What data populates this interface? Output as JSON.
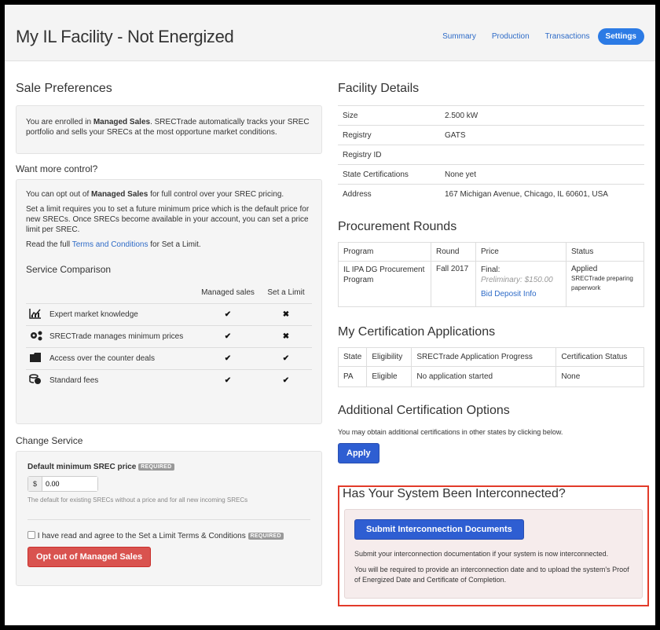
{
  "header": {
    "title": "My IL Facility - Not Energized",
    "nav": [
      "Summary",
      "Production",
      "Transactions",
      "Settings"
    ]
  },
  "sale_preferences": {
    "title": "Sale Preferences",
    "text_1": "You are enrolled in ",
    "text_bold": "Managed Sales",
    "text_2": ". SRECTrade automatically tracks your SREC portfolio and sells your SRECs at the most opportune market conditions."
  },
  "more_control": {
    "title": "Want more control?",
    "p1_a": "You can opt out of ",
    "p1_bold": "Managed Sales",
    "p1_b": " for full control over your SREC pricing.",
    "p2": "Set a limit requires you to set a future minimum price which is the default price for new SRECs. Once SRECs become available in your account, you can set a price limit per SREC.",
    "p3_a": "Read the full ",
    "p3_link": "Terms and Conditions",
    "p3_b": " for Set a Limit."
  },
  "service_comparison": {
    "title": "Service Comparison",
    "col_managed": "Managed sales",
    "col_limit": "Set a Limit",
    "rows": [
      {
        "icon": "chart-icon",
        "label": "Expert market knowledge",
        "managed": "✔",
        "limit": "✖"
      },
      {
        "icon": "gears-icon",
        "label": "SRECTrade manages minimum prices",
        "managed": "✔",
        "limit": "✖"
      },
      {
        "icon": "folder-icon",
        "label": "Access over the counter deals",
        "managed": "✔",
        "limit": "✔"
      },
      {
        "icon": "coins-icon",
        "label": "Standard fees",
        "managed": "✔",
        "limit": "✔"
      }
    ]
  },
  "change_service": {
    "title": "Change Service",
    "price_label": "Default minimum SREC price",
    "required": "REQUIRED",
    "currency": "$",
    "price_value": "0.00",
    "help": "The default for existing SRECs without a price and for all new incoming SRECs",
    "agree_label": "I have read and agree to the Set a Limit Terms & Conditions",
    "button": "Opt out of Managed Sales"
  },
  "facility_details": {
    "title": "Facility Details",
    "rows": [
      {
        "label": "Size",
        "value": "2.500 kW"
      },
      {
        "label": "Registry",
        "value": "GATS"
      },
      {
        "label": "Registry ID",
        "value": ""
      },
      {
        "label": "State Certifications",
        "value": "None yet"
      },
      {
        "label": "Address",
        "value": "167 Michigan Avenue, Chicago, IL 60601, USA"
      }
    ]
  },
  "procurement": {
    "title": "Procurement Rounds",
    "headers": [
      "Program",
      "Round",
      "Price",
      "Status"
    ],
    "program": "IL IPA DG Procurement Program",
    "round": "Fall 2017",
    "price_final": "Final:",
    "price_prelim": "Preliminary: $150.00",
    "price_link": "Bid Deposit Info",
    "status_main": "Applied",
    "status_sub": "SRECTrade preparing paperwork"
  },
  "cert_apps": {
    "title": "My Certification Applications",
    "headers": [
      "State",
      "Eligibility",
      "SRECTrade Application Progress",
      "Certification Status"
    ],
    "row": [
      "PA",
      "Eligible",
      "No application started",
      "None"
    ]
  },
  "additional": {
    "title": "Additional Certification Options",
    "text": "You may obtain additional certifications in other states by clicking below.",
    "button": "Apply"
  },
  "interconnect": {
    "title": "Has Your System Been Interconnected?",
    "button": "Submit Interconnection Documents",
    "p1": "Submit your interconnection documentation if your system is now interconnected.",
    "p2": "You will be required to provide an interconnection date and to upload the system's Proof of Energized Date and Certificate of Completion."
  },
  "colors": {
    "accent": "#2c7be5",
    "danger": "#d9534f",
    "highlight": "#e23b2a"
  }
}
